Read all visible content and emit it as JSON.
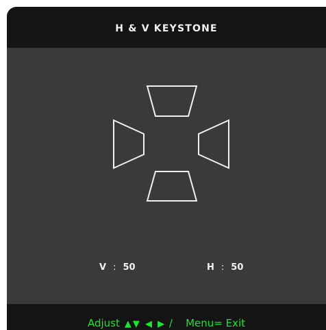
{
  "title": "H & V KEYSTONE",
  "readouts": {
    "v_label": "V",
    "v_sep": ":",
    "v_value": "50",
    "h_label": "H",
    "h_sep": ":",
    "h_value": "50"
  },
  "footer": {
    "adjust_label": "Adjust",
    "arrows": "▲▼ ◀ ▶",
    "slash": "/",
    "menu_exit": "Menu= Exit"
  },
  "colors": {
    "background": "#3a3a3a",
    "bar": "#141414",
    "text": "#f2f2f2",
    "footer_text": "#19e633"
  },
  "icons": [
    "keystone-top-trapezoid-icon",
    "keystone-left-trapezoid-icon",
    "keystone-right-trapezoid-icon",
    "keystone-bottom-trapezoid-icon"
  ]
}
